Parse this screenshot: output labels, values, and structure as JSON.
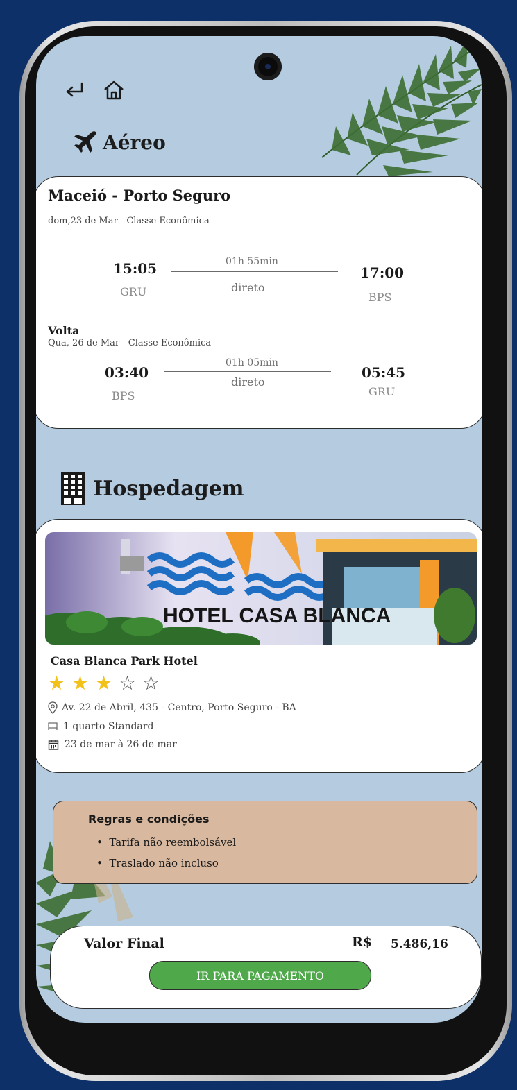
{
  "nav": {
    "back_icon": "return-arrow-icon",
    "home_icon": "home-icon"
  },
  "air": {
    "section_title": "Aéreo",
    "section_icon": "airplane-icon",
    "route": "Maceió - Porto Seguro",
    "outbound": {
      "subtitle": "dom,23 de Mar - Classe Econômica",
      "depart_time": "15:05",
      "depart_code": "GRU",
      "duration": "01h 55min",
      "type": "direto",
      "arrive_time": "17:00",
      "arrive_code": "BPS"
    },
    "return": {
      "label": "Volta",
      "subtitle": "Qua, 26 de Mar - Classe Econômica",
      "depart_time": "03:40",
      "depart_code": "BPS",
      "duration": "01h 05min",
      "type": "direto",
      "arrive_time": "05:45",
      "arrive_code": "GRU"
    }
  },
  "hotel": {
    "section_title": "Hospedagem",
    "section_icon": "building-icon",
    "photo_sign": "HOTEL CASA BLANCA",
    "name": "Casa Blanca Park Hotel",
    "rating": 3,
    "max_rating": 5,
    "address": "Av. 22 de Abril, 435 - Centro, Porto Seguro - BA",
    "room": "1 quarto Standard",
    "dates": "23 de mar à 26 de mar"
  },
  "rules": {
    "title": "Regras e condições",
    "items": [
      "Tarifa não reembolsável",
      "Traslado não incluso"
    ]
  },
  "total": {
    "label": "Valor Final",
    "currency": "R$",
    "amount": "5.486,16",
    "button_label": "IR PARA PAGAMENTO"
  },
  "colors": {
    "accent": "#4fa84a",
    "screen_bg": "#b5cce0",
    "frame_bg": "#0d3068",
    "rules_bg": "#d8b9a0",
    "star": "#f2c21b"
  }
}
